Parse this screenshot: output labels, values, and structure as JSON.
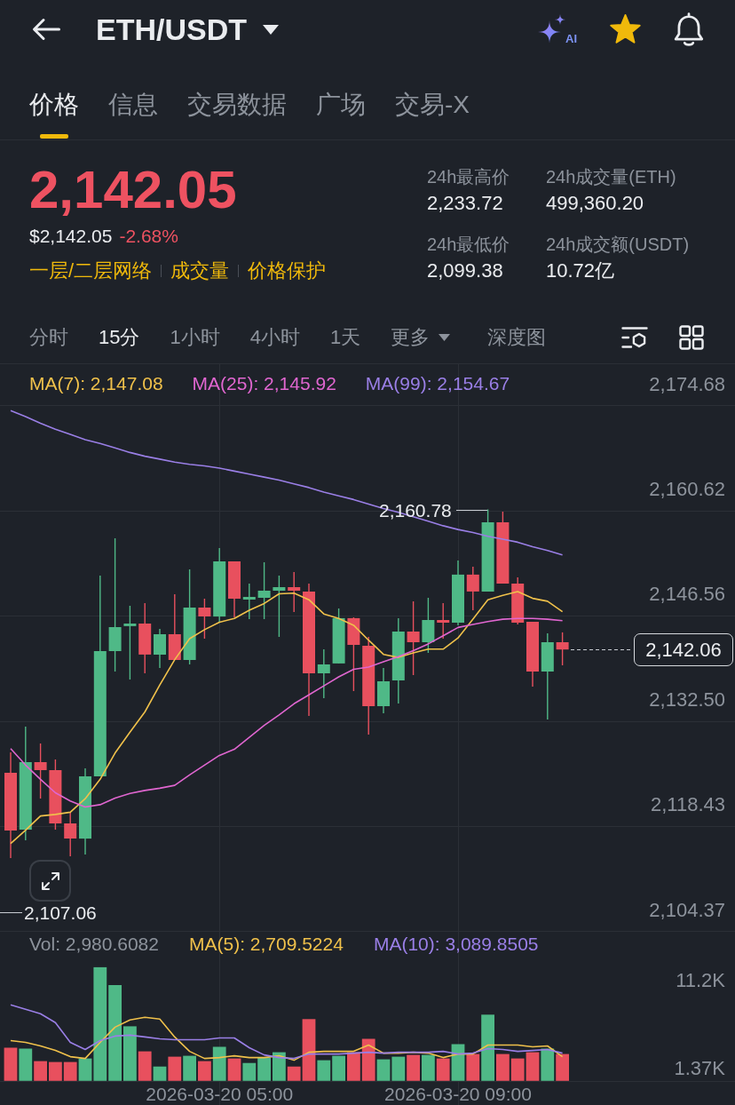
{
  "header": {
    "title": "ETH/USDT",
    "ai_label": "AI",
    "favorite": true
  },
  "tabs": [
    {
      "label": "价格",
      "selected": true
    },
    {
      "label": "信息",
      "selected": false
    },
    {
      "label": "交易数据",
      "selected": false
    },
    {
      "label": "广场",
      "selected": false
    },
    {
      "label": "交易-X",
      "selected": false
    }
  ],
  "ticker": {
    "price": "2,142.05",
    "falling": true,
    "usd_price": "$2,142.05",
    "change": "-2.68%",
    "links": [
      "一层/二层网络",
      "成交量",
      "价格保护"
    ],
    "stats": [
      {
        "label": "24h最高价",
        "value": "2,233.72"
      },
      {
        "label": "24h成交量(ETH)",
        "value": "499,360.20"
      },
      {
        "label": "24h最低价",
        "value": "2,099.38"
      },
      {
        "label": "24h成交额(USDT)",
        "value": "10.72亿"
      }
    ]
  },
  "intervals": [
    {
      "label": "分时",
      "kind": "option",
      "selected": false
    },
    {
      "label": "15分",
      "kind": "option",
      "selected": true
    },
    {
      "label": "1小时",
      "kind": "option",
      "selected": false
    },
    {
      "label": "4小时",
      "kind": "option",
      "selected": false
    },
    {
      "label": "1天",
      "kind": "option",
      "selected": false
    },
    {
      "label": "更多",
      "kind": "dropdown",
      "selected": false
    }
  ],
  "depth_chart": "深度图",
  "price_chart": {
    "high_label": "2,160.78",
    "low_label": "2,107.06",
    "last_price": "2,142.06",
    "chart_data": {
      "type": "candlestick",
      "grid": true,
      "categories": [
        null,
        null,
        null,
        null,
        null,
        null,
        null,
        null,
        null,
        null,
        null,
        null,
        null,
        null,
        null,
        null,
        null,
        null,
        null,
        null,
        null,
        null,
        null,
        null,
        null,
        null,
        null,
        null,
        null,
        null,
        null,
        null,
        null,
        null,
        null,
        null,
        null,
        null
      ],
      "ylim": [
        2104.37,
        2180.2
      ],
      "yticks": [
        {
          "value": 2174.68,
          "label": "2,174.68"
        },
        {
          "value": 2160.62,
          "label": "2,160.62"
        },
        {
          "value": 2146.56,
          "label": "2,146.56"
        },
        {
          "value": 2132.5,
          "label": "2,132.50"
        },
        {
          "value": 2118.43,
          "label": "2,118.43"
        },
        {
          "value": 2104.37,
          "label": "2,104.37"
        }
      ],
      "ohlc": [
        [
          2125.57,
          2128.3,
          2114.17,
          2117.85
        ],
        [
          2117.97,
          2131.75,
          2116.55,
          2127
        ],
        [
          2127,
          2129.49,
          2122.13,
          2125.93
        ],
        [
          2125.93,
          2127.35,
          2117.97,
          2118.8
        ],
        [
          2118.8,
          2120.23,
          2114.41,
          2116.78
        ],
        [
          2116.78,
          2126.17,
          2114.64,
          2125.1
        ],
        [
          2125.1,
          2151.94,
          2125.1,
          2141.84
        ],
        [
          2141.84,
          2156.92,
          2139.11,
          2145.05
        ],
        [
          2145.17,
          2147.9,
          2138.04,
          2145.52
        ],
        [
          2145.52,
          2148.25,
          2138.87,
          2141.37
        ],
        [
          2141.37,
          2144.81,
          2139.58,
          2144.1
        ],
        [
          2144.1,
          2149.44,
          2140.65,
          2140.65
        ],
        [
          2140.65,
          2152.77,
          2140.06,
          2147.66
        ],
        [
          2147.66,
          2148.85,
          2143.5,
          2146.47
        ],
        [
          2146.47,
          2155.62,
          2145.64,
          2153.84
        ],
        [
          2153.84,
          2153.84,
          2146.35,
          2148.85
        ],
        [
          2148.73,
          2150.87,
          2146.12,
          2149.09
        ],
        [
          2148.97,
          2153.72,
          2146.12,
          2149.92
        ],
        [
          2149.92,
          2151.94,
          2143.74,
          2150.39
        ],
        [
          2150.39,
          2152.41,
          2147.07,
          2149.92
        ],
        [
          2149.8,
          2150.87,
          2133.17,
          2138.87
        ],
        [
          2138.87,
          2142.08,
          2135.55,
          2140.06
        ],
        [
          2140.18,
          2147.54,
          2140.18,
          2146.24
        ],
        [
          2146.24,
          2146.35,
          2136.5,
          2142.67
        ],
        [
          2142.55,
          2143.74,
          2130.68,
          2134.48
        ],
        [
          2134.48,
          2139.58,
          2133.53,
          2137.8
        ],
        [
          2137.92,
          2146.24,
          2134.83,
          2144.45
        ],
        [
          2144.45,
          2148.49,
          2138.63,
          2143.03
        ],
        [
          2143.03,
          2148.97,
          2141.6,
          2146
        ],
        [
          2146,
          2148.25,
          2143.5,
          2145.64
        ],
        [
          2145.64,
          2153.96,
          2145.29,
          2152.06
        ],
        [
          2152.06,
          2153.12,
          2147.3,
          2149.8
        ],
        [
          2149.8,
          2160.78,
          2149.8,
          2159.06
        ],
        [
          2159.06,
          2160.49,
          2150.87,
          2150.87
        ],
        [
          2150.87,
          2151.7,
          2145.4,
          2145.64
        ],
        [
          2145.76,
          2145.76,
          2137.09,
          2139.11
        ],
        [
          2139.11,
          2144.22,
          2132.7,
          2143.03
        ],
        [
          2143.03,
          2144.34,
          2139.94,
          2142.06
        ]
      ],
      "series": [
        {
          "name": "MA(7): 2,147.08",
          "type": "line",
          "color": "#f0c14b",
          "values": [
            2116.1,
            2117.9,
            2119.8,
            2120,
            2120.3,
            2122.1,
            2124.7,
            2128.2,
            2131,
            2133.7,
            2137.3,
            2140.7,
            2143.5,
            2144.7,
            2145.7,
            2146.2,
            2147.3,
            2148.2,
            2149.5,
            2149.6,
            2148.7,
            2146.8,
            2146.2,
            2145.3,
            2143.3,
            2141.4,
            2141,
            2141.6,
            2142.1,
            2142.1,
            2143.6,
            2146.1,
            2148.7,
            2149.3,
            2149.8,
            2148.9,
            2148.5,
            2147.1
          ]
        },
        {
          "name": "MA(25): 2,145.92",
          "type": "line",
          "color": "#e066d0",
          "values": [
            2128.8,
            2126.6,
            2124.7,
            2122.9,
            2121.8,
            2121,
            2121.3,
            2122.2,
            2122.8,
            2123.2,
            2123.5,
            2123.9,
            2125.3,
            2126.6,
            2127.9,
            2128.7,
            2130.3,
            2131.9,
            2133.3,
            2134.8,
            2136,
            2137.2,
            2138.4,
            2139.4,
            2139.7,
            2140.4,
            2141.1,
            2141.9,
            2142.8,
            2143.9,
            2145,
            2145.4,
            2145.8,
            2146.1,
            2146.2,
            2146.2,
            2146.1,
            2145.9
          ]
        },
        {
          "name": "MA(99): 2,154.67",
          "type": "line",
          "color": "#9a7fe6",
          "values": [
            2174,
            2173.2,
            2172.3,
            2171.5,
            2170.8,
            2170.1,
            2169.6,
            2169,
            2168.4,
            2167.9,
            2167.5,
            2167.1,
            2166.8,
            2166.6,
            2166.3,
            2165.9,
            2165.5,
            2165.1,
            2164.7,
            2164.2,
            2163.7,
            2163.1,
            2162.6,
            2162.1,
            2161.5,
            2160.9,
            2160.4,
            2159.8,
            2159.2,
            2158.6,
            2158.1,
            2157.7,
            2157.2,
            2156.8,
            2156.4,
            2155.8,
            2155.3,
            2154.7
          ]
        }
      ]
    }
  },
  "volume_chart": {
    "chart_data": {
      "type": "bar",
      "grid": true,
      "categories": [
        null,
        null,
        null,
        null,
        null,
        null,
        null,
        null,
        null,
        null,
        null,
        null,
        null,
        null,
        "2026-03-20 05:00",
        null,
        null,
        null,
        null,
        null,
        null,
        null,
        null,
        null,
        null,
        null,
        null,
        null,
        null,
        null,
        "2026-03-20 09:00",
        null,
        null,
        null,
        null,
        null,
        null,
        null
      ],
      "ylim": [
        0,
        16760
      ],
      "yticks": [
        {
          "value": 11200,
          "label": "11.2K"
        },
        {
          "value": 1370,
          "label": "1.37K"
        }
      ],
      "series": [
        {
          "name": "Vol: 2,980.6082",
          "colors": [
            "#e8505e",
            "#4fb987",
            "#e8505e",
            "#e8505e",
            "#e8505e",
            "#4fb987",
            "#4fb987",
            "#4fb987",
            "#4fb987",
            "#e8505e",
            "#4fb987",
            "#e8505e",
            "#4fb987",
            "#e8505e",
            "#4fb987",
            "#e8505e",
            "#4fb987",
            "#4fb987",
            "#4fb987",
            "#e8505e",
            "#e8505e",
            "#4fb987",
            "#4fb987",
            "#e8505e",
            "#e8505e",
            "#4fb987",
            "#4fb987",
            "#e8505e",
            "#4fb987",
            "#e8505e",
            "#4fb987",
            "#e8505e",
            "#4fb987",
            "#e8505e",
            "#e8505e",
            "#e8505e",
            "#4fb987",
            "#e8505e"
          ],
          "values": [
            3700,
            3600,
            2200,
            2100,
            2100,
            2500,
            12700,
            10700,
            6100,
            3300,
            1600,
            2700,
            2800,
            2200,
            3800,
            2500,
            2000,
            2600,
            3200,
            1600,
            6900,
            2300,
            2800,
            3200,
            4700,
            2400,
            2700,
            2900,
            2900,
            2500,
            4100,
            3000,
            7400,
            3000,
            2500,
            3200,
            3600,
            3000
          ]
        },
        {
          "name": "MA(5): 2,709.5224",
          "type": "line",
          "color": "#f0c14b",
          "values": [
            4500,
            4300,
            3900,
            3400,
            2700,
            2500,
            4300,
            6000,
            6800,
            7100,
            6900,
            4900,
            3300,
            2500,
            2600,
            2800,
            2600,
            2600,
            2800,
            2300,
            3200,
            3300,
            3300,
            3300,
            4000,
            3100,
            3100,
            3200,
            3100,
            2600,
            3000,
            3000,
            4000,
            4000,
            4000,
            3800,
            3900,
            2700
          ]
        },
        {
          "name": "MA(10): 3,089.8505",
          "type": "line",
          "color": "#9a7fe6",
          "values": [
            8500,
            8000,
            7500,
            6500,
            4300,
            3500,
            4500,
            5000,
            5100,
            4900,
            4700,
            4600,
            4600,
            4600,
            4800,
            4800,
            3700,
            2900,
            2600,
            2500,
            3000,
            3000,
            3000,
            3100,
            3200,
            3100,
            3200,
            3200,
            3200,
            3300,
            3000,
            3100,
            3600,
            3500,
            3300,
            3400,
            3500,
            3100
          ]
        }
      ]
    }
  }
}
